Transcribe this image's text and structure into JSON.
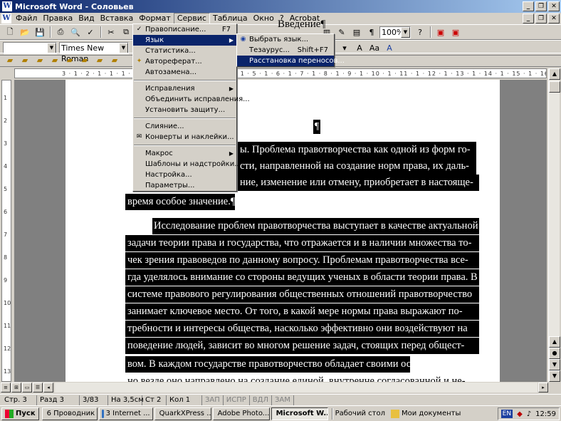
{
  "window": {
    "title": "Microsoft Word - Соловьев",
    "app_icon": "W"
  },
  "menubar": {
    "items": [
      "Файл",
      "Правка",
      "Вид",
      "Вставка",
      "Формат",
      "Сервис",
      "Таблица",
      "Окно",
      "?",
      "Acrobat"
    ],
    "active": "Сервис"
  },
  "toolbar": {
    "style_value": "",
    "font_value": "Times New Roman",
    "zoom_value": "100%"
  },
  "service_menu": {
    "items": [
      {
        "label": "Правописание...",
        "shortcut": "F7"
      },
      {
        "label": "Язык",
        "submenu": true
      },
      {
        "label": "Статистика..."
      },
      {
        "label": "Автореферат..."
      },
      {
        "label": "Автозамена..."
      },
      {
        "label": "Исправления",
        "submenu": true
      },
      {
        "label": "Объединить исправления..."
      },
      {
        "label": "Установить защиту..."
      },
      {
        "label": "Слияние..."
      },
      {
        "label": "Конверты и наклейки..."
      },
      {
        "label": "Макрос",
        "submenu": true
      },
      {
        "label": "Шаблоны и надстройки..."
      },
      {
        "label": "Настройка..."
      },
      {
        "label": "Параметры..."
      }
    ]
  },
  "language_submenu": {
    "items": [
      {
        "label": "Выбрать язык..."
      },
      {
        "label": "Тезаурус...",
        "shortcut": "Shift+F7"
      },
      {
        "label": "Расстановка переносов..."
      }
    ]
  },
  "document": {
    "heading": "Введение¶",
    "para_mark": "¶",
    "lines": [
      "ы. Проблема правотворчества как одной из форм го-",
      "сти, направленной на создание норм права, их даль-",
      "ние, изменение или отмену, приобретает в настояще-",
      "время особое значение.¶",
      "Исследование проблем правотворчества выступает в качестве актуальной",
      "задачи теории права и государства, что отражается и в наличии множества то-",
      "чек зрения правоведов по данному вопросу. Проблемам правотворчества все-",
      "гда уделялось внимание со стороны ведущих ученых в области теории права. В",
      "системе правового регулирования общественных отношений правотворчество",
      "занимает ключевое место. От того, в какой мере нормы права выражают по-",
      "требности и интересы общества, насколько эффективно они воздействуют на",
      "поведение людей, зависит во многом решение задач, стоящих перед общест-",
      "вом. В каждом государстве правотворчество обладает своими особенностями,",
      "но везде оно направлено на создание единой, внутренне согласованной и не-"
    ]
  },
  "statusbar": {
    "page": "Стр. 3",
    "section": "Разд 3",
    "pages": "3/83",
    "at": "На 3,5см",
    "line": "Ст 2",
    "col": "Кол 1",
    "rec": "ЗАП",
    "trk": "ИСПР",
    "ext": "ВДЛ",
    "ovr": "ЗАМ"
  },
  "taskbar": {
    "start": "Пуск",
    "tasks": [
      "6 Проводник",
      "3 Internet ...",
      "QuarkXPress ...",
      "Adobe Photo...",
      "Microsoft W..."
    ],
    "active_task": "Microsoft W...",
    "desktop": "Рабочий стол",
    "mydocs": "Мои документы",
    "lang": "EN",
    "clock": "12:59"
  },
  "ruler_text": "3 · 1 · 2 · 1 · 1 · 1 · ⌂ · 1 · 1 · 1 · 2 · 1 · 3 · 1 · 4 · 1 · 5 · 1 · 6 · 1 · 7 · 1 · 8 · 1 · 9 · 1 · 10 · 1 · 11 · 1 · 12 · 1 · 13 · 1 · 14 · 1 · 15 · 1 · 16 · 1 · 17",
  "vruler_text": [
    "1",
    "2",
    "3",
    "4",
    "5",
    "6",
    "7",
    "8",
    "9",
    "10",
    "11",
    "12",
    "13"
  ]
}
